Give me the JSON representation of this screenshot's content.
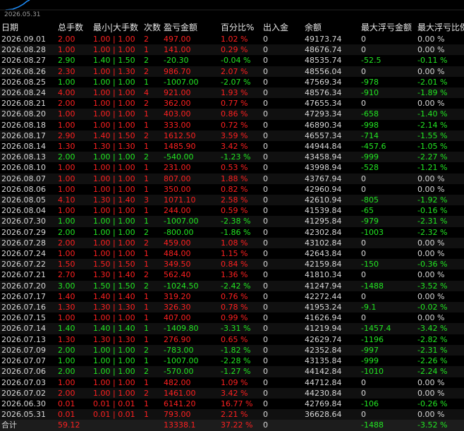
{
  "chart": {
    "axis_date": "2026.05.31"
  },
  "headers": [
    "日期",
    "总手数",
    "最小|大手数",
    "次数",
    "盈亏金额",
    "百分比%",
    "出入金",
    "余额",
    "最大浮亏金额",
    "最大浮亏比例"
  ],
  "rows": [
    [
      "2026.09.01",
      "2.00",
      "1.00 | 1.00",
      "2",
      "497.00",
      "1.02 %",
      "0",
      "49173.74",
      "0",
      "0.00 %",
      "r"
    ],
    [
      "2026.08.28",
      "1.00",
      "1.00 | 1.00",
      "1",
      "141.00",
      "0.29 %",
      "0",
      "48676.74",
      "0",
      "0.00 %",
      "r"
    ],
    [
      "2026.08.27",
      "2.90",
      "1.40 | 1.50",
      "2",
      "-20.30",
      "-0.04 %",
      "0",
      "48535.74",
      "-52.5",
      "-0.11 %",
      "g"
    ],
    [
      "2026.08.26",
      "2.30",
      "1.00 | 1.30",
      "2",
      "986.70",
      "2.07 %",
      "0",
      "48556.04",
      "0",
      "0.00 %",
      "r"
    ],
    [
      "2026.08.25",
      "1.00",
      "1.00 | 1.00",
      "1",
      "-1007.00",
      "-2.07 %",
      "0",
      "47569.34",
      "-978",
      "-2.01 %",
      "g"
    ],
    [
      "2026.08.24",
      "4.00",
      "1.00 | 1.00",
      "4",
      "921.00",
      "1.93 %",
      "0",
      "48576.34",
      "-910",
      "-1.89 %",
      "r"
    ],
    [
      "2026.08.21",
      "2.00",
      "1.00 | 1.00",
      "2",
      "362.00",
      "0.77 %",
      "0",
      "47655.34",
      "0",
      "0.00 %",
      "r"
    ],
    [
      "2026.08.20",
      "1.00",
      "1.00 | 1.00",
      "1",
      "403.00",
      "0.86 %",
      "0",
      "47293.34",
      "-658",
      "-1.40 %",
      "r"
    ],
    [
      "2026.08.18",
      "1.00",
      "1.00 | 1.00",
      "1",
      "333.00",
      "0.72 %",
      "0",
      "46890.34",
      "-998",
      "-2.14 %",
      "r"
    ],
    [
      "2026.08.17",
      "2.90",
      "1.40 | 1.50",
      "2",
      "1612.50",
      "3.59 %",
      "0",
      "46557.34",
      "-714",
      "-1.55 %",
      "r"
    ],
    [
      "2026.08.14",
      "1.30",
      "1.30 | 1.30",
      "1",
      "1485.90",
      "3.42 %",
      "0",
      "44944.84",
      "-457.6",
      "-1.05 %",
      "r"
    ],
    [
      "2026.08.13",
      "2.00",
      "1.00 | 1.00",
      "2",
      "-540.00",
      "-1.23 %",
      "0",
      "43458.94",
      "-999",
      "-2.27 %",
      "g"
    ],
    [
      "2026.08.10",
      "1.00",
      "1.00 | 1.00",
      "1",
      "231.00",
      "0.53 %",
      "0",
      "43998.94",
      "-528",
      "-1.21 %",
      "r"
    ],
    [
      "2026.08.07",
      "1.00",
      "1.00 | 1.00",
      "1",
      "807.00",
      "1.88 %",
      "0",
      "43767.94",
      "0",
      "0.00 %",
      "r"
    ],
    [
      "2026.08.06",
      "1.00",
      "1.00 | 1.00",
      "1",
      "350.00",
      "0.82 %",
      "0",
      "42960.94",
      "0",
      "0.00 %",
      "r"
    ],
    [
      "2026.08.05",
      "4.10",
      "1.30 | 1.40",
      "3",
      "1071.10",
      "2.58 %",
      "0",
      "42610.94",
      "-805",
      "-1.92 %",
      "r"
    ],
    [
      "2026.08.04",
      "1.00",
      "1.00 | 1.00",
      "1",
      "244.00",
      "0.59 %",
      "0",
      "41539.84",
      "-65",
      "-0.16 %",
      "r"
    ],
    [
      "2026.07.30",
      "1.00",
      "1.00 | 1.00",
      "1",
      "-1007.00",
      "-2.38 %",
      "0",
      "41295.84",
      "-979",
      "-2.31 %",
      "g"
    ],
    [
      "2026.07.29",
      "2.00",
      "1.00 | 1.00",
      "2",
      "-800.00",
      "-1.86 %",
      "0",
      "42302.84",
      "-1003",
      "-2.32 %",
      "g"
    ],
    [
      "2026.07.28",
      "2.00",
      "1.00 | 1.00",
      "2",
      "459.00",
      "1.08 %",
      "0",
      "43102.84",
      "0",
      "0.00 %",
      "r"
    ],
    [
      "2026.07.24",
      "1.00",
      "1.00 | 1.00",
      "1",
      "484.00",
      "1.15 %",
      "0",
      "42643.84",
      "0",
      "0.00 %",
      "r"
    ],
    [
      "2026.07.22",
      "1.50",
      "1.50 | 1.50",
      "1",
      "349.50",
      "0.84 %",
      "0",
      "42159.84",
      "-150",
      "-0.36 %",
      "r"
    ],
    [
      "2026.07.21",
      "2.70",
      "1.30 | 1.40",
      "2",
      "562.40",
      "1.36 %",
      "0",
      "41810.34",
      "0",
      "0.00 %",
      "r"
    ],
    [
      "2026.07.20",
      "3.00",
      "1.50 | 1.50",
      "2",
      "-1024.50",
      "-2.42 %",
      "0",
      "41247.94",
      "-1488",
      "-3.52 %",
      "g"
    ],
    [
      "2026.07.17",
      "1.40",
      "1.40 | 1.40",
      "1",
      "319.20",
      "0.76 %",
      "0",
      "42272.44",
      "0",
      "0.00 %",
      "r"
    ],
    [
      "2026.07.16",
      "1.30",
      "1.30 | 1.30",
      "1",
      "326.30",
      "0.78 %",
      "0",
      "41953.24",
      "-9.1",
      "-0.02 %",
      "r"
    ],
    [
      "2026.07.15",
      "1.00",
      "1.00 | 1.00",
      "1",
      "407.00",
      "0.99 %",
      "0",
      "41626.94",
      "0",
      "0.00 %",
      "r"
    ],
    [
      "2026.07.14",
      "1.40",
      "1.40 | 1.40",
      "1",
      "-1409.80",
      "-3.31 %",
      "0",
      "41219.94",
      "-1457.4",
      "-3.42 %",
      "g"
    ],
    [
      "2026.07.13",
      "1.30",
      "1.30 | 1.30",
      "1",
      "276.90",
      "0.65 %",
      "0",
      "42629.74",
      "-1196",
      "-2.82 %",
      "r"
    ],
    [
      "2026.07.09",
      "2.00",
      "1.00 | 1.00",
      "2",
      "-783.00",
      "-1.82 %",
      "0",
      "42352.84",
      "-997",
      "-2.31 %",
      "g"
    ],
    [
      "2026.07.07",
      "1.00",
      "1.00 | 1.00",
      "1",
      "-1007.00",
      "-2.28 %",
      "0",
      "43135.84",
      "-999",
      "-2.26 %",
      "g"
    ],
    [
      "2026.07.06",
      "2.00",
      "1.00 | 1.00",
      "2",
      "-570.00",
      "-1.27 %",
      "0",
      "44142.84",
      "-1010",
      "-2.24 %",
      "g"
    ],
    [
      "2026.07.03",
      "1.00",
      "1.00 | 1.00",
      "1",
      "482.00",
      "1.09 %",
      "0",
      "44712.84",
      "0",
      "0.00 %",
      "r"
    ],
    [
      "2026.07.02",
      "2.00",
      "1.00 | 1.00",
      "2",
      "1461.00",
      "3.42 %",
      "0",
      "44230.84",
      "0",
      "0.00 %",
      "r"
    ],
    [
      "2026.06.30",
      "0.01",
      "0.01 | 0.01",
      "1",
      "6141.20",
      "16.77 %",
      "0",
      "42769.84",
      "-106",
      "-0.26 %",
      "r"
    ],
    [
      "2026.05.31",
      "0.01",
      "0.01 | 0.01",
      "1",
      "793.00",
      "2.21 %",
      "0",
      "36628.64",
      "0",
      "0.00 %",
      "r"
    ]
  ],
  "total": [
    "合计",
    "59.12",
    "",
    "",
    "13338.1",
    "37.22 %",
    "0",
    "",
    "-1488",
    "-3.52 %"
  ],
  "colors": {
    "profit": "#ff2020",
    "loss": "#22e622",
    "text": "#d8d8d8",
    "background": "#000000"
  }
}
